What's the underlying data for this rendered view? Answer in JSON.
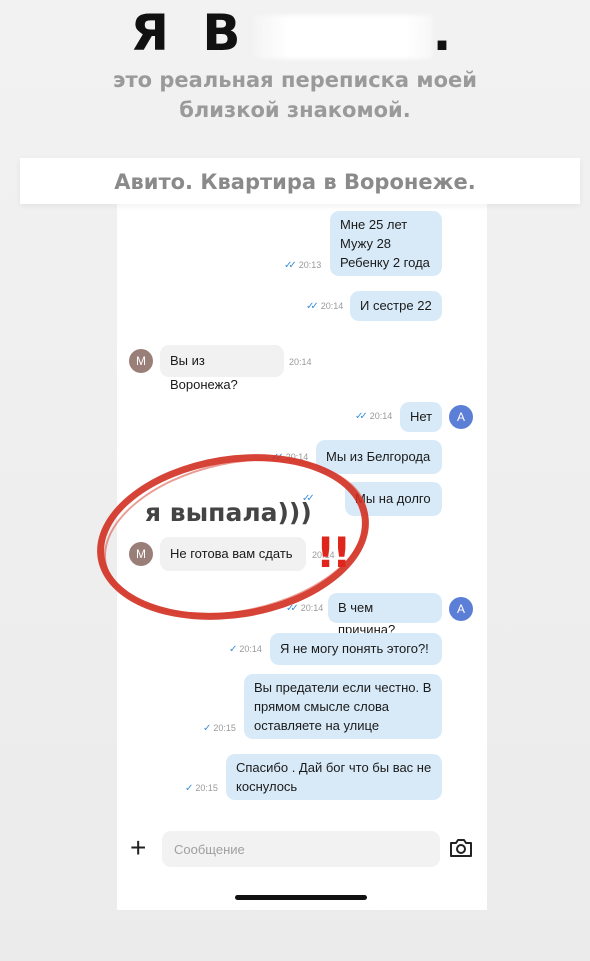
{
  "headline": {
    "text": "Я В",
    "dot": "."
  },
  "subtitle": {
    "line1": "это реальная переписка моей",
    "line2": "близкой знакомой."
  },
  "banner": {
    "text": "Авито. Квартира в Воронеже."
  },
  "messages": [
    {
      "side": "out",
      "lines": [
        "Мне 25 лет",
        "Мужу 28",
        "Ребенку 2 года"
      ],
      "time": "20:13"
    },
    {
      "side": "out",
      "lines": [
        "И сестре 22"
      ],
      "time": "20:14"
    },
    {
      "side": "in",
      "avatar": "М",
      "lines": [
        "Вы из Воронежа?"
      ],
      "time": "20:14"
    },
    {
      "side": "out",
      "avatar": "А",
      "lines": [
        "Нет"
      ],
      "time": "20:14"
    },
    {
      "side": "out",
      "lines": [
        "Мы из Белгорода"
      ],
      "time": "20:14"
    },
    {
      "side": "out",
      "lines": [
        "Мы на долго"
      ],
      "time": ""
    },
    {
      "side": "in",
      "avatar": "М",
      "lines": [
        "Не готова вам сдать"
      ],
      "time": "20:14"
    },
    {
      "side": "out",
      "avatar": "А",
      "lines": [
        "В чем причина?"
      ],
      "time": "20:14"
    },
    {
      "side": "out",
      "lines": [
        "Я не могу понять этого?!"
      ],
      "time": "20:14"
    },
    {
      "side": "out",
      "lines": [
        "Вы предатели если честно. В",
        "прямом смысле слова",
        "оставляете на улице"
      ],
      "time": "20:15"
    },
    {
      "side": "out",
      "lines": [
        "Спасибо . Дай бог что бы вас не",
        "коснулось"
      ],
      "time": "20:15"
    }
  ],
  "annotation": {
    "text": "я выпала)))",
    "marks": "!!"
  },
  "composer": {
    "placeholder": "Сообщение",
    "plus_icon": "plus-icon",
    "camera_icon": "camera-icon"
  },
  "colors": {
    "outgoing_bubble": "#d8eaf8",
    "incoming_bubble": "#f1f1f1",
    "circle": "#d02a1c",
    "avatar_m": "#9a7f78",
    "avatar_a": "#5b7fd6"
  }
}
